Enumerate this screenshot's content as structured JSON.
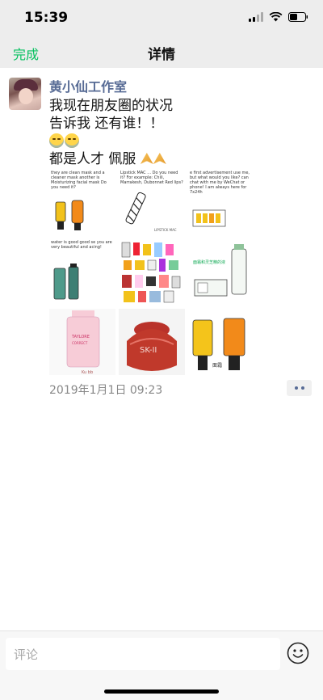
{
  "status_bar": {
    "time": "15:39",
    "icons": [
      "signal-icon",
      "wifi-icon",
      "battery-icon"
    ]
  },
  "nav": {
    "done_label": "完成",
    "title": "详情"
  },
  "post": {
    "author": "黄小仙工作室",
    "lines": [
      "我现在朋友圈的状况",
      "告诉我 还有谁！！",
      "",
      "都是人才 佩服"
    ],
    "emojis": [
      "crying-laughing-emoji",
      "crying-laughing-emoji",
      "pray-emoji",
      "pray-emoji"
    ],
    "timestamp": "2019年1月1日 09:23",
    "images": [
      {
        "name": "skincare-mask-sketch",
        "caption": "they are clean mask and a cleaner mask another is Moisturizing facial mask Do you need it?"
      },
      {
        "name": "lipstick-sketch",
        "caption": "Lipstick MAC ... Do you need it? For example: Chili, Marrakesh, Dubonnet Red lips?"
      },
      {
        "name": "advertisement-sketch",
        "caption": "e first advertisement use me, but what would you like? can chat with me by WeChat or phone! I am always here for 7x24h"
      },
      {
        "name": "toner-sketch",
        "caption": "water is good good se you are very beautiful and acing!"
      },
      {
        "name": "product-collage",
        "caption": ""
      },
      {
        "name": "bottle-set-sketch",
        "caption": "面霜和灵芝精的液"
      },
      {
        "name": "pink-bottle-sketch",
        "caption": ""
      },
      {
        "name": "skii-jar-painting",
        "caption": "SK-II"
      },
      {
        "name": "two-bottles-sketch",
        "caption": "面霜"
      }
    ]
  },
  "comment": {
    "placeholder": "评论"
  },
  "colors": {
    "accent_green": "#07c160",
    "name_blue": "#576b95",
    "bar_bg": "#ededed"
  }
}
